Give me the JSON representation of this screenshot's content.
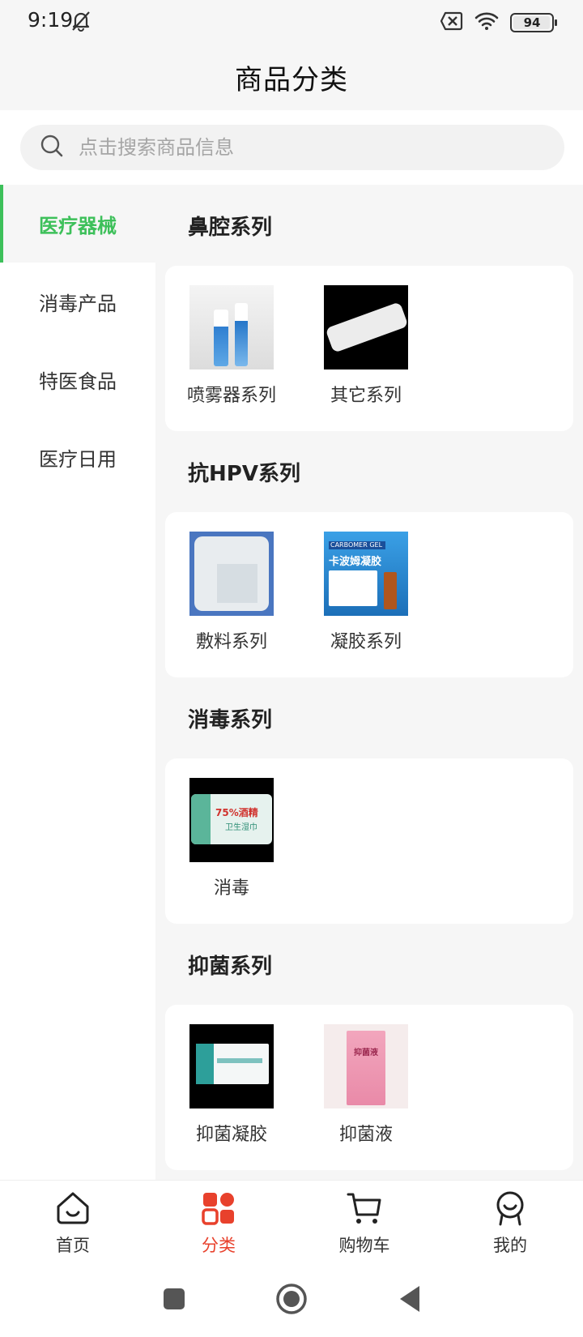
{
  "status": {
    "time": "9:19",
    "battery": "94"
  },
  "header": {
    "title": "商品分类"
  },
  "search": {
    "placeholder": "点击搜索商品信息"
  },
  "sidebar": {
    "items": [
      {
        "label": "医疗器械",
        "active": true
      },
      {
        "label": "消毒产品",
        "active": false
      },
      {
        "label": "特医食品",
        "active": false
      },
      {
        "label": "医疗日用",
        "active": false
      }
    ]
  },
  "sections": [
    {
      "title": "鼻腔系列",
      "products": [
        {
          "name": "喷雾器系列"
        },
        {
          "name": "其它系列"
        }
      ]
    },
    {
      "title": "抗HPV系列",
      "products": [
        {
          "name": "敷料系列"
        },
        {
          "name": "凝胶系列"
        }
      ]
    },
    {
      "title": "消毒系列",
      "products": [
        {
          "name": "消毒"
        }
      ]
    },
    {
      "title": "抑菌系列",
      "products": [
        {
          "name": "抑菌凝胶"
        },
        {
          "name": "抑菌液"
        }
      ]
    }
  ],
  "product_image_text": {
    "gel_box_brand": "CARBOMER GEL",
    "gel_box_name": "卡波姆凝胶",
    "disinfect_pack_line1": "75%酒精",
    "disinfect_pack_line2": "卫生湿巾",
    "antibac_box_name": "抑菌液"
  },
  "bottom_nav": {
    "items": [
      {
        "label": "首页",
        "icon": "home-icon",
        "active": false
      },
      {
        "label": "分类",
        "icon": "category-icon",
        "active": true
      },
      {
        "label": "购物车",
        "icon": "cart-icon",
        "active": false
      },
      {
        "label": "我的",
        "icon": "profile-icon",
        "active": false
      }
    ]
  },
  "colors": {
    "accent_green": "#3dc05a",
    "accent_red": "#e8412c"
  }
}
